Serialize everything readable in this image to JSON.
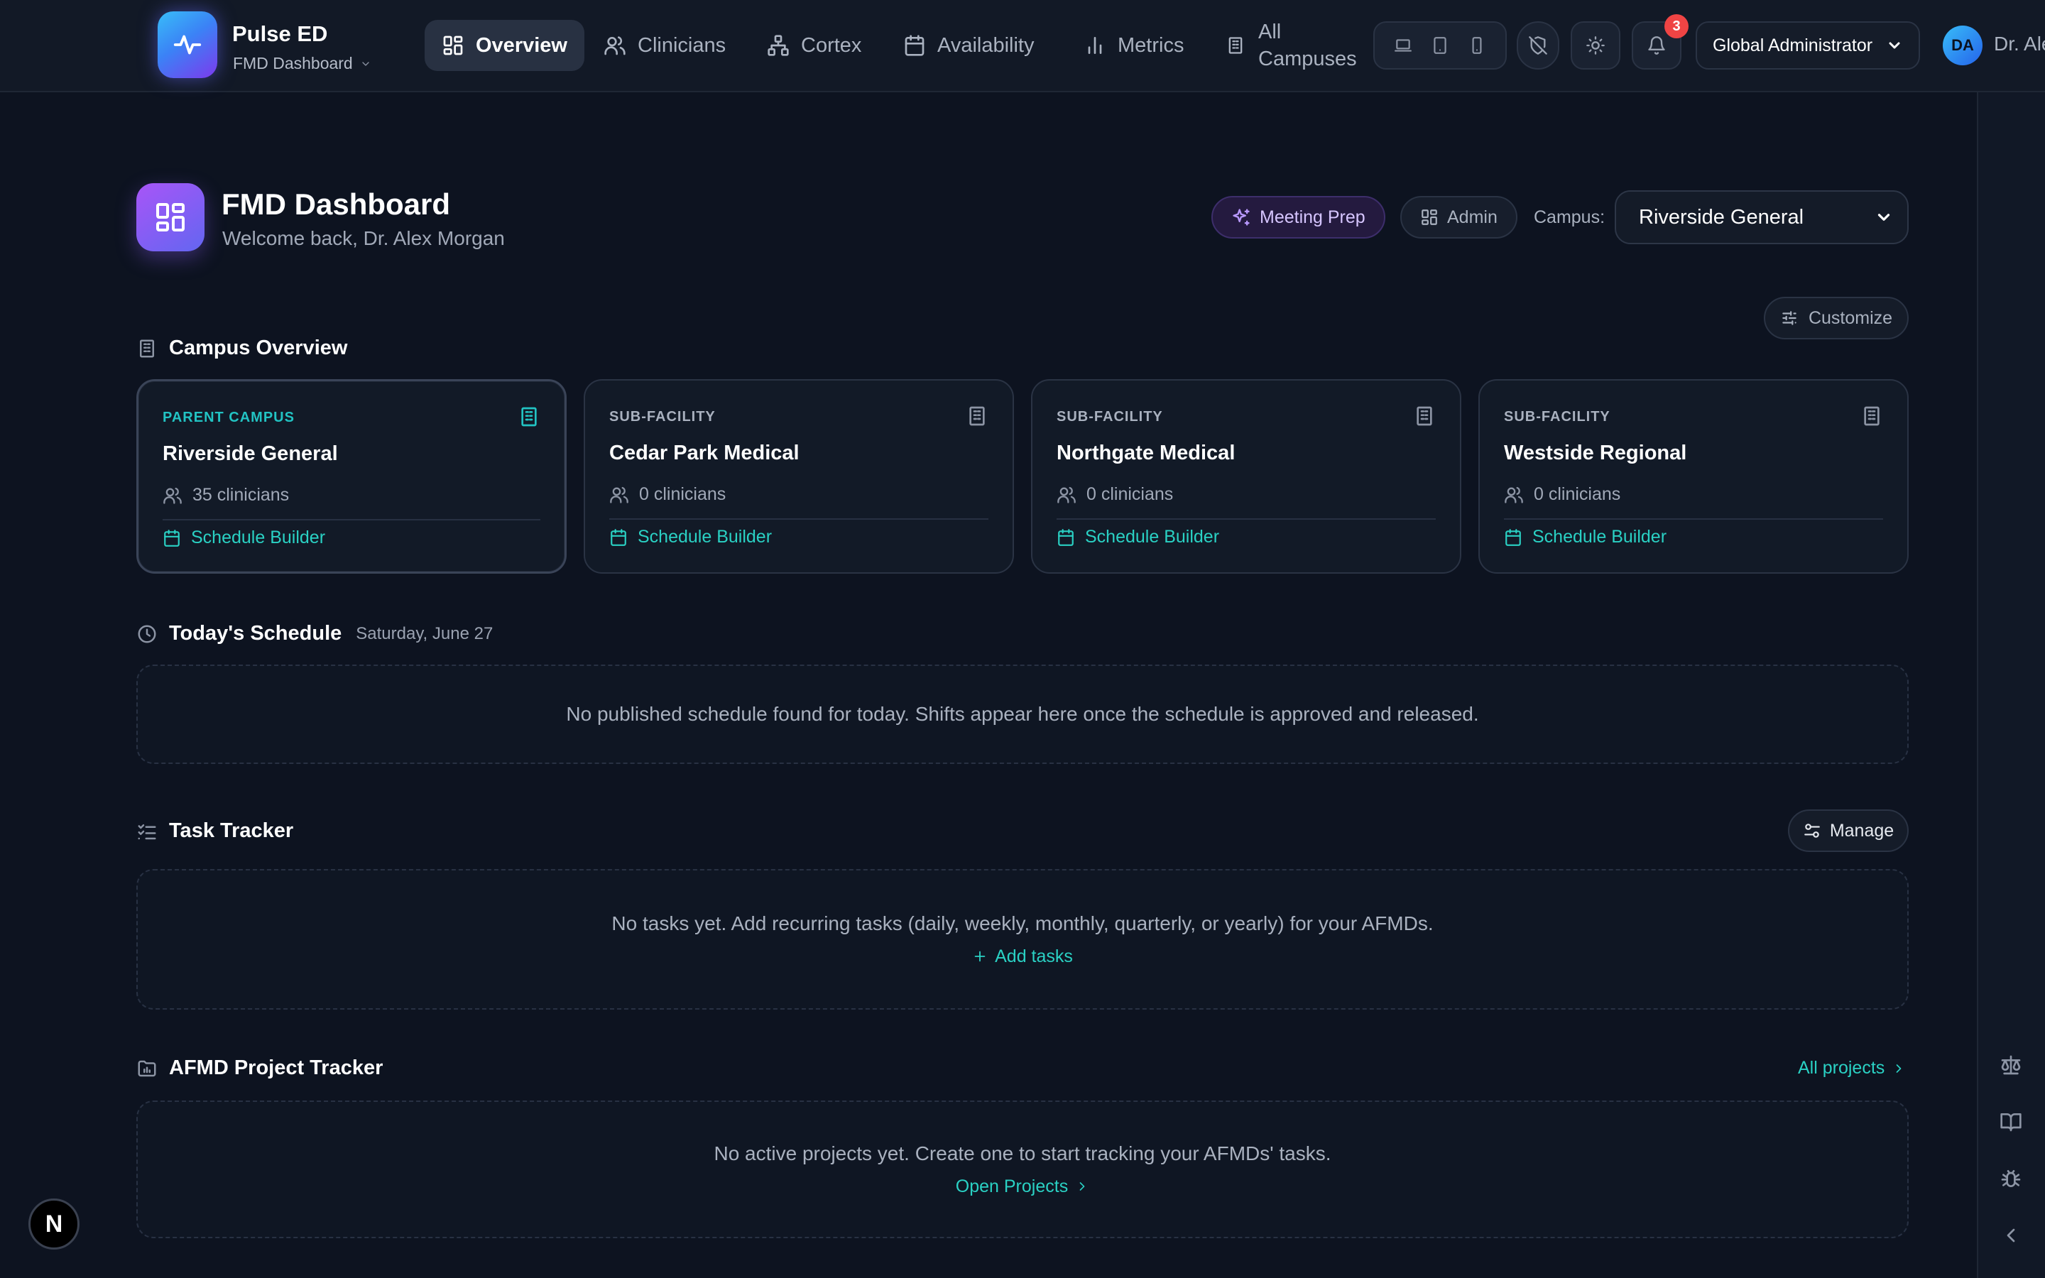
{
  "brand": {
    "name": "Pulse ED",
    "subtitle": "FMD Dashboard"
  },
  "nav": {
    "overview": "Overview",
    "clinicians": "Clinicians",
    "cortex": "Cortex",
    "availability": "Availability",
    "metrics": "Metrics",
    "campuses_line1": "All",
    "campuses_line2": "Campuses"
  },
  "notifications": {
    "count": "3"
  },
  "role": {
    "selected": "Global Administrator"
  },
  "user": {
    "initials": "DA",
    "name": "Dr. Ale"
  },
  "header": {
    "title": "FMD Dashboard",
    "welcome": "Welcome back, Dr. Alex Morgan",
    "meeting_prep": "Meeting Prep",
    "admin": "Admin",
    "campus_label": "Campus:",
    "campus_selected": "Riverside General",
    "customize": "Customize"
  },
  "campus_overview": {
    "title": "Campus Overview",
    "cards": [
      {
        "type": "PARENT CAMPUS",
        "name": "Riverside General",
        "clinicians": "35 clinicians",
        "link": "Schedule Builder"
      },
      {
        "type": "SUB-FACILITY",
        "name": "Cedar Park Medical",
        "clinicians": "0 clinicians",
        "link": "Schedule Builder"
      },
      {
        "type": "SUB-FACILITY",
        "name": "Northgate Medical",
        "clinicians": "0 clinicians",
        "link": "Schedule Builder"
      },
      {
        "type": "SUB-FACILITY",
        "name": "Westside Regional",
        "clinicians": "0 clinicians",
        "link": "Schedule Builder"
      }
    ]
  },
  "schedule": {
    "title": "Today's Schedule",
    "date": "Saturday, June 27",
    "empty": "No published schedule found for today. Shifts appear here once the schedule is approved and released."
  },
  "tasks": {
    "title": "Task Tracker",
    "manage": "Manage",
    "empty": "No tasks yet. Add recurring tasks (daily, weekly, monthly, quarterly, or yearly) for your AFMDs.",
    "add": "Add tasks"
  },
  "projects": {
    "title": "AFMD Project Tracker",
    "all_link": "All projects",
    "empty": "No active projects yet. Create one to start tracking your AFMDs' tasks.",
    "open": "Open Projects"
  },
  "dev_badge": "N",
  "colors": {
    "accent_teal": "#2ad1c4",
    "accent_purple": "#8b5cf6",
    "badge_red": "#ef4444",
    "background": "#0d1320"
  }
}
